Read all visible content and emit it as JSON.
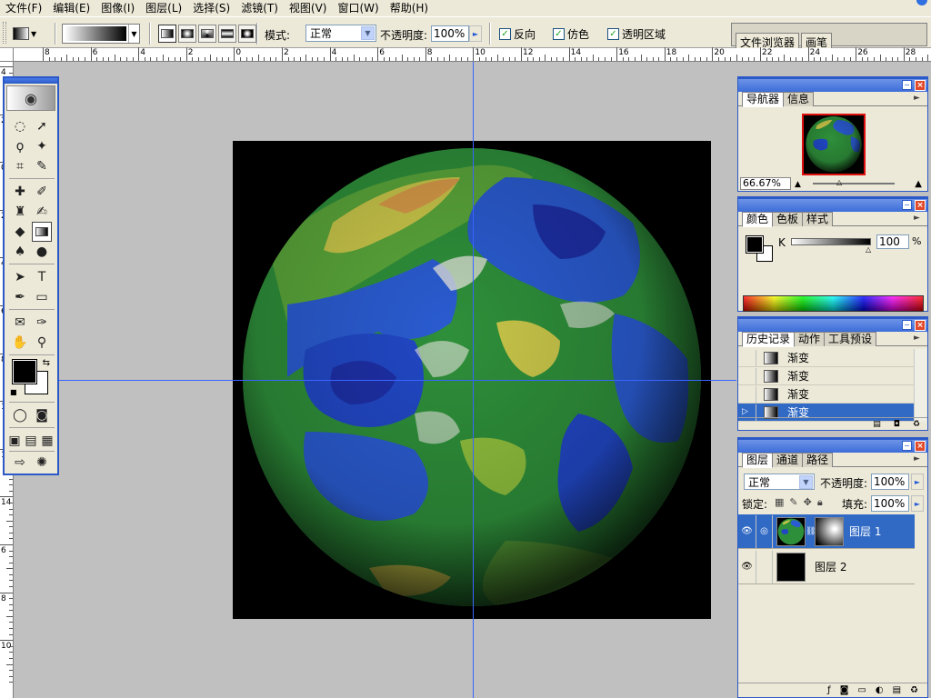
{
  "menu": [
    "文件(F)",
    "编辑(E)",
    "图像(I)",
    "图层(L)",
    "选择(S)",
    "滤镜(T)",
    "视图(V)",
    "窗口(W)",
    "帮助(H)"
  ],
  "options": {
    "mode_label": "模式:",
    "mode_value": "正常",
    "opacity_label": "不透明度:",
    "opacity_value": "100%",
    "reverse_label": "反向",
    "dither_label": "仿色",
    "transparency_label": "透明区域",
    "well_tabs": [
      "文件浏览器",
      "画笔"
    ]
  },
  "rulers": {
    "h": [
      "8",
      "6",
      "4",
      "2",
      "0",
      "2",
      "4",
      "6",
      "8",
      "10",
      "12",
      "14",
      "16",
      "18",
      "20",
      "22",
      "24",
      "26",
      "28"
    ],
    "v": [
      "4",
      "2",
      "0",
      "2",
      "4",
      "6",
      "8",
      "10",
      "12",
      "14",
      "6",
      "8",
      "10"
    ]
  },
  "navigator": {
    "tabs": [
      "导航器",
      "信息"
    ],
    "zoom": "66.67%"
  },
  "color": {
    "tabs": [
      "颜色",
      "色板",
      "样式"
    ],
    "channel": "K",
    "value": "100",
    "unit": "%"
  },
  "history": {
    "tabs": [
      "历史记录",
      "动作",
      "工具预设"
    ],
    "items": [
      "渐变",
      "渐变",
      "渐变",
      "渐变"
    ]
  },
  "layers": {
    "tabs": [
      "图层",
      "通道",
      "路径"
    ],
    "blend_mode": "正常",
    "opacity_label": "不透明度:",
    "opacity_value": "100%",
    "lock_label": "锁定:",
    "fill_label": "填充:",
    "fill_value": "100%",
    "items": [
      {
        "name": "图层 1"
      },
      {
        "name": "图层 2"
      }
    ]
  },
  "colors": {
    "accent": "#2b59c7",
    "selection": "#316ac5",
    "guide": "#3a64ff",
    "canvas_bg": "#c0c0c0"
  },
  "icons": {
    "tools": [
      "marquee-icon",
      "move-icon",
      "lasso-icon",
      "magic-wand-icon",
      "crop-icon",
      "slice-icon",
      "healing-brush-icon",
      "brush-icon",
      "clone-stamp-icon",
      "history-brush-icon",
      "eraser-icon",
      "gradient-icon",
      "blur-icon",
      "dodge-icon",
      "path-selection-icon",
      "type-icon",
      "pen-icon",
      "shape-icon",
      "notes-icon",
      "eyedropper-icon",
      "hand-icon",
      "zoom-icon"
    ]
  }
}
